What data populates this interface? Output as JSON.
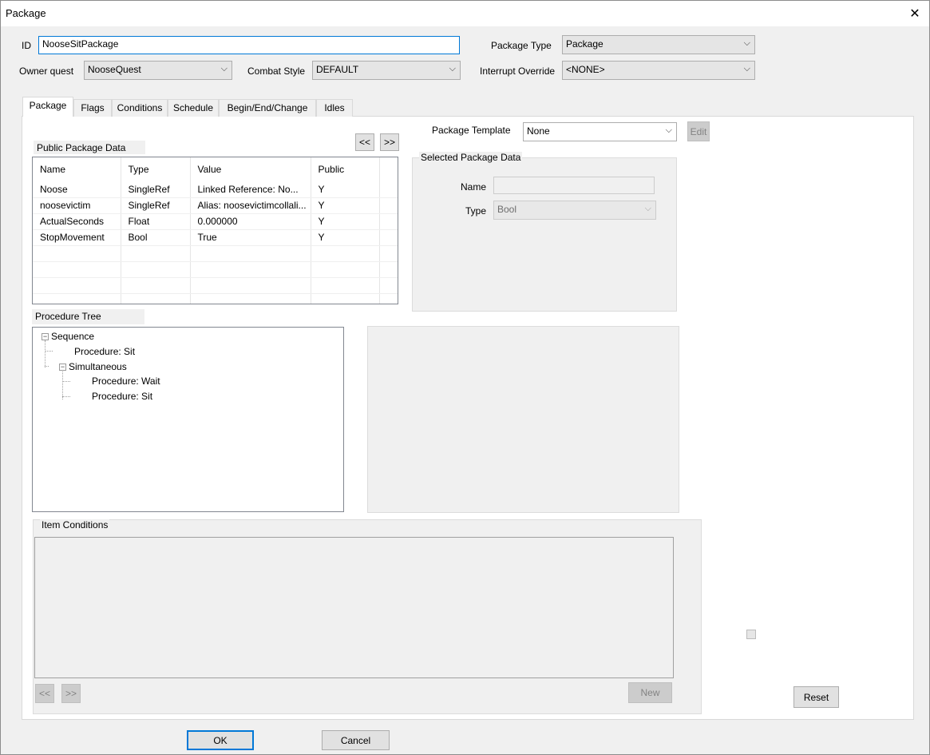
{
  "window": {
    "title": "Package",
    "close_glyph": "✕"
  },
  "header": {
    "id_label": "ID",
    "id_value": "NooseSitPackage",
    "owner_quest_label": "Owner quest",
    "owner_quest_value": "NooseQuest",
    "combat_style_label": "Combat Style",
    "combat_style_value": "DEFAULT",
    "package_type_label": "Package Type",
    "package_type_value": "Package",
    "interrupt_override_label": "Interrupt Override",
    "interrupt_override_value": "<NONE>"
  },
  "tabs": [
    {
      "label": "Package"
    },
    {
      "label": "Flags"
    },
    {
      "label": "Conditions"
    },
    {
      "label": "Schedule"
    },
    {
      "label": "Begin/End/Change"
    },
    {
      "label": "Idles"
    }
  ],
  "package_tab": {
    "public_data_title": "Public Package Data",
    "move_left": "<<",
    "move_right": ">>",
    "template_label": "Package Template",
    "template_value": "None",
    "edit_label": "Edit",
    "columns": [
      "Name",
      "Type",
      "Value",
      "Public"
    ],
    "rows": [
      [
        "Noose",
        "SingleRef",
        "Linked Reference: No...",
        "Y"
      ],
      [
        "noosevictim",
        "SingleRef",
        "Alias: noosevictimcollali...",
        "Y"
      ],
      [
        "ActualSeconds",
        "Float",
        "0.000000",
        "Y"
      ],
      [
        "StopMovement",
        "Bool",
        "True",
        "Y"
      ]
    ],
    "selected_title": "Selected Package Data",
    "name_label": "Name",
    "name_value": "",
    "type_label": "Type",
    "type_value": "Bool",
    "procedure_tree_title": "Procedure Tree",
    "tree": {
      "sequence": "Sequence",
      "proc_sit_1": "Procedure: Sit",
      "simultaneous": "Simultaneous",
      "proc_wait": "Procedure: Wait",
      "proc_sit_2": "Procedure: Sit"
    },
    "item_conditions_title": "Item Conditions",
    "cond_prev": "<<",
    "cond_next": ">>",
    "new_label": "New",
    "reset_label": "Reset"
  },
  "footer": {
    "ok_label": "OK",
    "cancel_label": "Cancel"
  },
  "icons": {
    "dropdown": "chevron-down-icon",
    "expander": "collapse-minus-icon",
    "close": "close-icon"
  }
}
